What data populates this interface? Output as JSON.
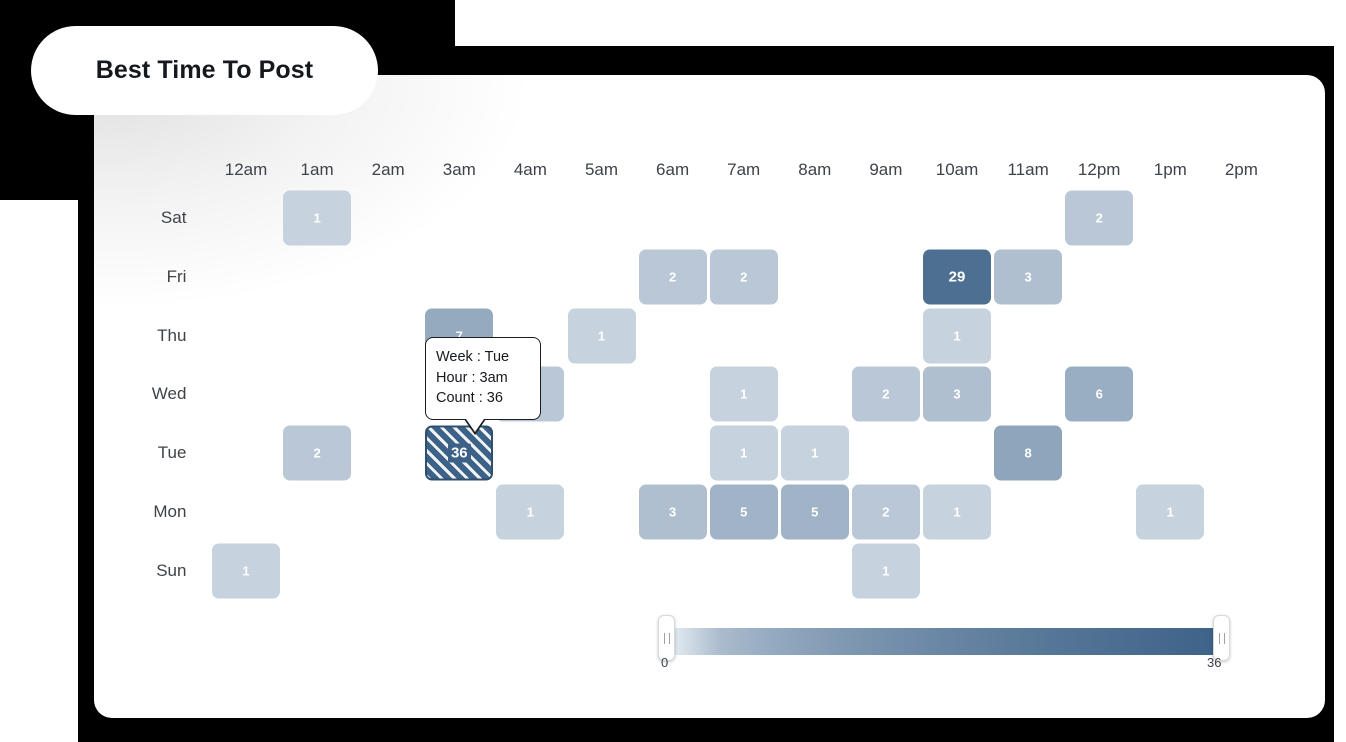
{
  "title": "Best Time To Post",
  "chart_data": {
    "type": "heatmap",
    "title": "Best Time To Post",
    "xlabel": "",
    "ylabel": "",
    "x_categories": [
      "12am",
      "1am",
      "2am",
      "3am",
      "4am",
      "5am",
      "6am",
      "7am",
      "8am",
      "9am",
      "10am",
      "11am",
      "12pm",
      "1pm",
      "2pm"
    ],
    "y_categories": [
      "Sat",
      "Fri",
      "Thu",
      "Wed",
      "Tue",
      "Mon",
      "Sun"
    ],
    "value_label": "Count",
    "colorscale": {
      "min": 0,
      "max": 36,
      "low_color": "#edf2f7",
      "high_color": "#3d6288"
    },
    "cells": [
      {
        "day": "Sat",
        "hour": "1am",
        "value": 1
      },
      {
        "day": "Sat",
        "hour": "12pm",
        "value": 2
      },
      {
        "day": "Fri",
        "hour": "6am",
        "value": 2
      },
      {
        "day": "Fri",
        "hour": "7am",
        "value": 2
      },
      {
        "day": "Fri",
        "hour": "10am",
        "value": 29
      },
      {
        "day": "Fri",
        "hour": "11am",
        "value": 3
      },
      {
        "day": "Thu",
        "hour": "3am",
        "value": 7
      },
      {
        "day": "Thu",
        "hour": "5am",
        "value": 1
      },
      {
        "day": "Thu",
        "hour": "10am",
        "value": 1
      },
      {
        "day": "Wed",
        "hour": "4am",
        "value": 2
      },
      {
        "day": "Wed",
        "hour": "7am",
        "value": 1
      },
      {
        "day": "Wed",
        "hour": "9am",
        "value": 2
      },
      {
        "day": "Wed",
        "hour": "10am",
        "value": 3
      },
      {
        "day": "Wed",
        "hour": "12pm",
        "value": 6
      },
      {
        "day": "Tue",
        "hour": "1am",
        "value": 2
      },
      {
        "day": "Tue",
        "hour": "3am",
        "value": 36,
        "selected": true
      },
      {
        "day": "Tue",
        "hour": "7am",
        "value": 1
      },
      {
        "day": "Tue",
        "hour": "8am",
        "value": 1
      },
      {
        "day": "Tue",
        "hour": "11am",
        "value": 8
      },
      {
        "day": "Mon",
        "hour": "4am",
        "value": 1
      },
      {
        "day": "Mon",
        "hour": "6am",
        "value": 3
      },
      {
        "day": "Mon",
        "hour": "7am",
        "value": 5
      },
      {
        "day": "Mon",
        "hour": "8am",
        "value": 5
      },
      {
        "day": "Mon",
        "hour": "9am",
        "value": 2
      },
      {
        "day": "Mon",
        "hour": "10am",
        "value": 1
      },
      {
        "day": "Mon",
        "hour": "1pm",
        "value": 1
      },
      {
        "day": "Sun",
        "hour": "12am",
        "value": 1
      },
      {
        "day": "Sun",
        "hour": "9am",
        "value": 1
      }
    ]
  },
  "tooltip": {
    "week_line": "Week : Tue",
    "hour_line": "Hour : 3am",
    "count_line": "Count : 36"
  },
  "legend": {
    "min_label": "0",
    "max_label": "36"
  }
}
